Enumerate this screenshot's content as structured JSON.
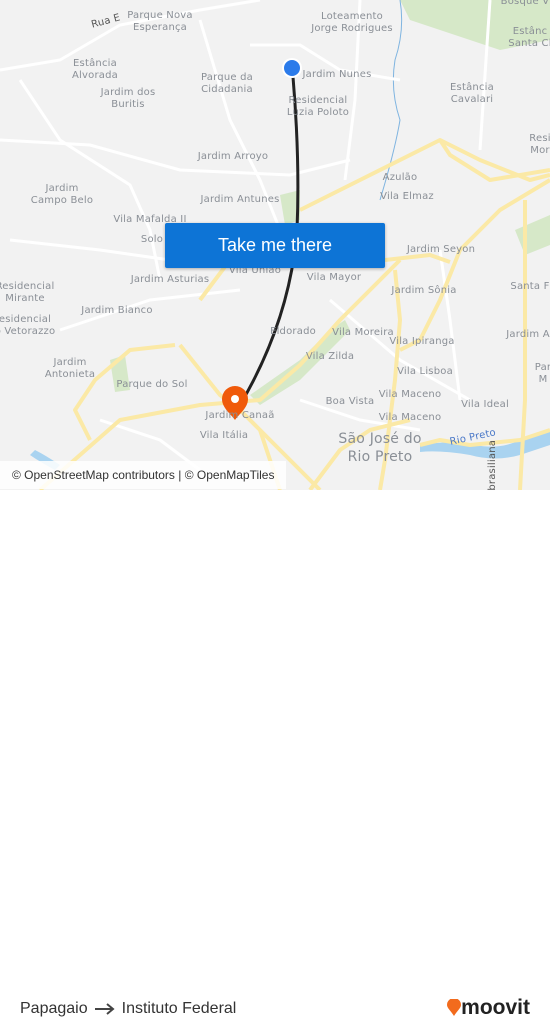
{
  "map": {
    "labels": [
      "Rua E",
      "Parque Nova\nEsperança",
      "Loteamento\nJorge Rodrigues",
      "Bosque V",
      "Estânc\nSanta Cl",
      "Estância\nAlvorada",
      "Parque da\nCidadania",
      "Jardim Nunes",
      "Jardim dos\nBuritis",
      "Residencial\nLuzia Poloto",
      "Estância\nCavalari",
      "Resi\nMor",
      "Jardim Arroyo",
      "Azulão",
      "Jardim\nCampo Belo",
      "Jardim Antunes",
      "Vila Elmaz",
      "Vila Mafalda II",
      "Solo",
      "Jardim Seyon",
      "Vila União",
      "Vila Mayor",
      "Jardim Asturias",
      "Santa F",
      "Jardim Sônia",
      "Residencial\nMirante",
      "Jardim Bianco",
      "esidencial\no Vetorazzo",
      "Eldorado",
      "Vila Moreira",
      "Vila Ipiranga",
      "Jardim A",
      "Vila Zilda",
      "Jardim\nAntonieta",
      "Vila Lisboa",
      "Par\nM",
      "Parque do Sol",
      "Boa Vista",
      "Vila Maceno",
      "Vila Ideal",
      "Jardim Canaã",
      "Vila Maceno",
      "Vila Itália",
      "São José do\nRio Preto",
      "Rio Preto",
      "sbrasiliana"
    ],
    "origin_marker": "blue-dot",
    "destination_marker": "orange-pin",
    "colors": {
      "route": "#222222",
      "origin": "#2b7bea",
      "destination": "#f05a0a",
      "major_road": "#fbe9a6",
      "button": "#0d74d6"
    }
  },
  "cta": {
    "label": "Take me there"
  },
  "attribution": "© OpenStreetMap contributors | © OpenMapTiles",
  "footer": {
    "from": "Papagaio",
    "to": "Instituto Federal",
    "arrow_icon": "arrow-right",
    "brand": "moovit"
  }
}
